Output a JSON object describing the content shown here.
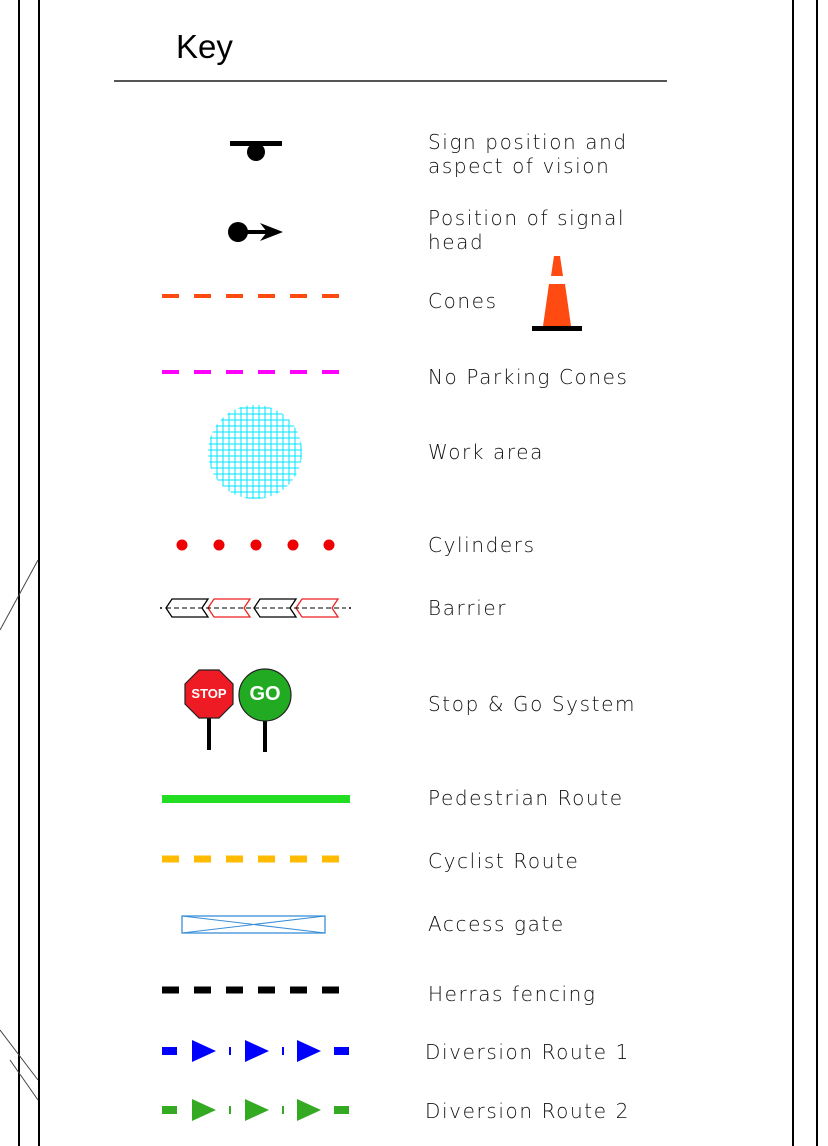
{
  "title": "Key",
  "items": [
    {
      "label": "Sign position and\naspect of vision",
      "icon": "sign-position-icon"
    },
    {
      "label": "Position of signal\nhead",
      "icon": "signal-head-icon"
    },
    {
      "label": "Cones",
      "icon": "cones-line-icon",
      "color": "#ff4a12"
    },
    {
      "label": "No Parking Cones",
      "icon": "no-parking-cones-icon",
      "color": "#ff00ff"
    },
    {
      "label": "Work area",
      "icon": "work-area-icon",
      "color": "#00e5ff"
    },
    {
      "label": "Cylinders",
      "icon": "cylinders-icon",
      "color": "#ee0000"
    },
    {
      "label": "Barrier",
      "icon": "barrier-icon"
    },
    {
      "label": "Stop & Go System",
      "icon": "stop-go-icon"
    },
    {
      "label": "Pedestrian Route",
      "icon": "pedestrian-route-icon",
      "color": "#22dd22"
    },
    {
      "label": "Cyclist Route",
      "icon": "cyclist-route-icon",
      "color": "#ffbb00"
    },
    {
      "label": "Access gate",
      "icon": "access-gate-icon",
      "color": "#3a8fd8"
    },
    {
      "label": "Herras fencing",
      "icon": "herras-fencing-icon",
      "color": "#000000"
    },
    {
      "label": "Diversion Route 1",
      "icon": "diversion-route-1-icon",
      "color": "#0000ff"
    },
    {
      "label": "Diversion Route 2",
      "icon": "diversion-route-2-icon",
      "color": "#33aa22"
    }
  ],
  "stop_sign_text": "STOP",
  "go_sign_text": "GO"
}
